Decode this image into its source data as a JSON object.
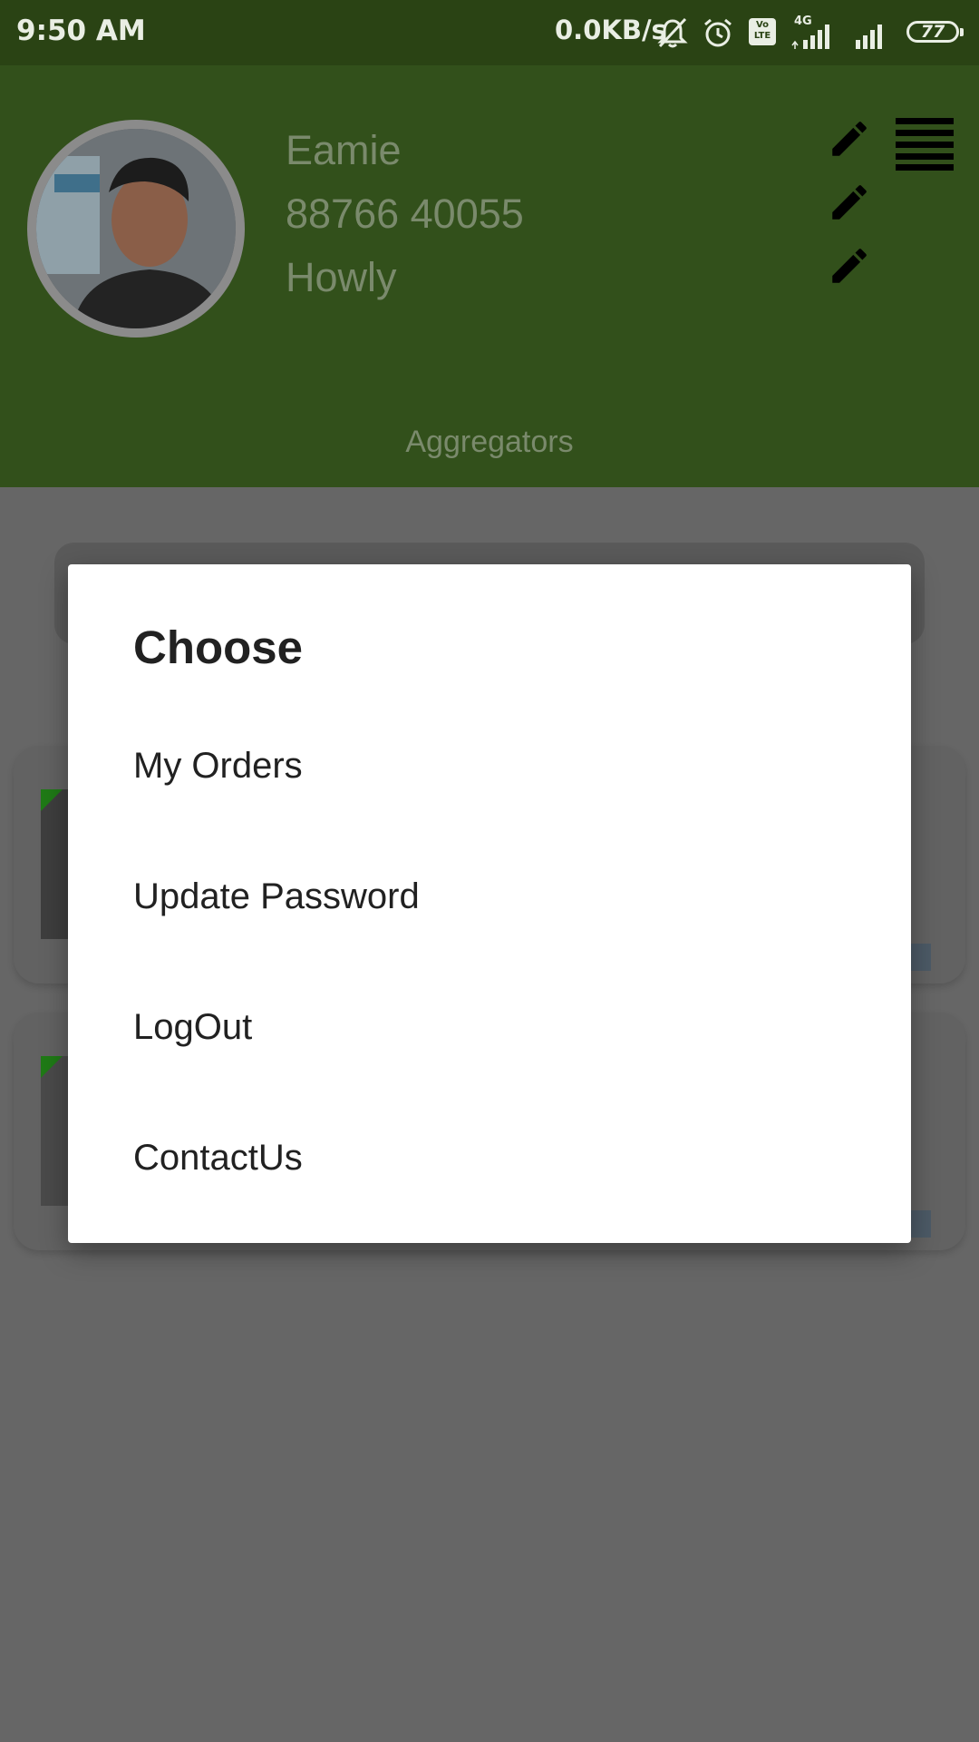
{
  "status_bar": {
    "time": "9:50 AM",
    "network_speed": "0.0KB/s",
    "volte_label": "Vo LTE",
    "network_type": "4G",
    "battery_level": "77",
    "icons": [
      "mute-notifications-icon",
      "alarm-icon",
      "volte-icon",
      "signal-icon",
      "signal-icon",
      "battery-icon"
    ]
  },
  "profile": {
    "name": "Eamie",
    "phone": "88766 40055",
    "location": "Howly",
    "edit_icons": [
      "pencil-icon",
      "pencil-icon",
      "pencil-icon"
    ],
    "menu_icon": "menu-icon"
  },
  "header": {
    "section_label": "Aggregators"
  },
  "dialog": {
    "title": "Choose",
    "items": [
      {
        "label": "My Orders"
      },
      {
        "label": "Update Password"
      },
      {
        "label": "LogOut"
      },
      {
        "label": "ContactUs"
      }
    ]
  },
  "colors": {
    "status_bar": "#2a4314",
    "header_dimmed": "#32501b",
    "scrim": "#666666",
    "dialog_bg": "#ffffff",
    "text_primary": "#212121"
  }
}
